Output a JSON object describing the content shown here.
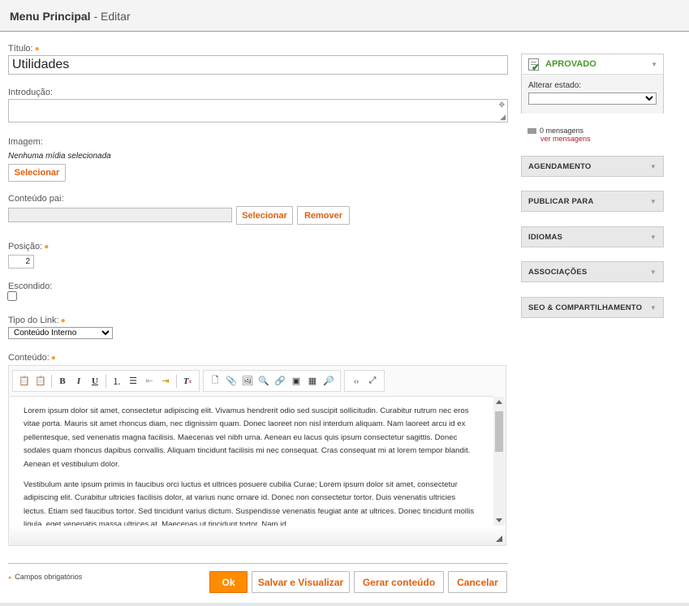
{
  "header": {
    "title": "Menu Principal",
    "separator": " - ",
    "subtitle": "Editar"
  },
  "form": {
    "titulo_label": "Título:",
    "titulo_value": "Utilidades",
    "introducao_label": "Introdução:",
    "imagem_label": "Imagem:",
    "imagem_none": "Nenhuma mídia selecionada",
    "imagem_select": "Selecionar",
    "conteudo_pai_label": "Conteúdo pai:",
    "conteudo_pai_select": "Selecionar",
    "conteudo_pai_remove": "Remover",
    "posicao_label": "Posição:",
    "posicao_value": "2",
    "escondido_label": "Escondido:",
    "tipo_link_label": "Tipo do Link:",
    "tipo_link_value": "Conteúdo Interno",
    "conteudo_label": "Conteúdo:",
    "required_mark": "●"
  },
  "editor": {
    "paragraphs": [
      "Lorem ipsum dolor sit amet, consectetur adipiscing elit. Vivamus hendrerit odio sed suscipit sollicitudin. Curabitur rutrum nec eros vitae porta. Mauris sit amet rhoncus diam, nec dignissim quam. Donec laoreet non nisl interdum aliquam. Nam laoreet arcu id ex pellentesque, sed venenatis magna facilisis. Maecenas vel nibh urna. Aenean eu lacus quis ipsum consectetur sagittis. Donec sodales quam rhoncus dapibus convallis. Aliquam tincidunt facilisis mi nec consequat. Cras consequat mi at lorem tempor blandit. Aenean et vestibulum dolor.",
      "Vestibulum ante ipsum primis in faucibus orci luctus et ultrices posuere cubilia Curae; Lorem ipsum dolor sit amet, consectetur adipiscing elit. Curabitur ultricies facilisis dolor, at varius nunc ornare id. Donec non consectetur tortor. Duis venenatis ultricies lectus. Etiam sed faucibus tortor. Sed tincidunt varius dictum. Suspendisse venenatis feugiat ante at ultrices. Donec tincidunt mollis ligula, eget venenatis massa ultrices at. Maecenas ut tincidunt tortor. Nam id."
    ]
  },
  "status": {
    "state": "APROVADO",
    "change_label": "Alterar estado:",
    "messages_count": "0 mensagens",
    "messages_link": "ver mensagens",
    "color": "#4a9a2a"
  },
  "panels": [
    "AGENDAMENTO",
    "PUBLICAR PARA",
    "IDIOMAS",
    "ASSOCIAÇÕES",
    "SEO & COMPARTILHAMENTO"
  ],
  "footer": {
    "required_note": "Campos obrigatórios",
    "ok": "Ok",
    "save_preview": "Salvar e Visualizar",
    "generate": "Gerar conteúdo",
    "cancel": "Cancelar",
    "ok_color": "#ff8c00"
  }
}
